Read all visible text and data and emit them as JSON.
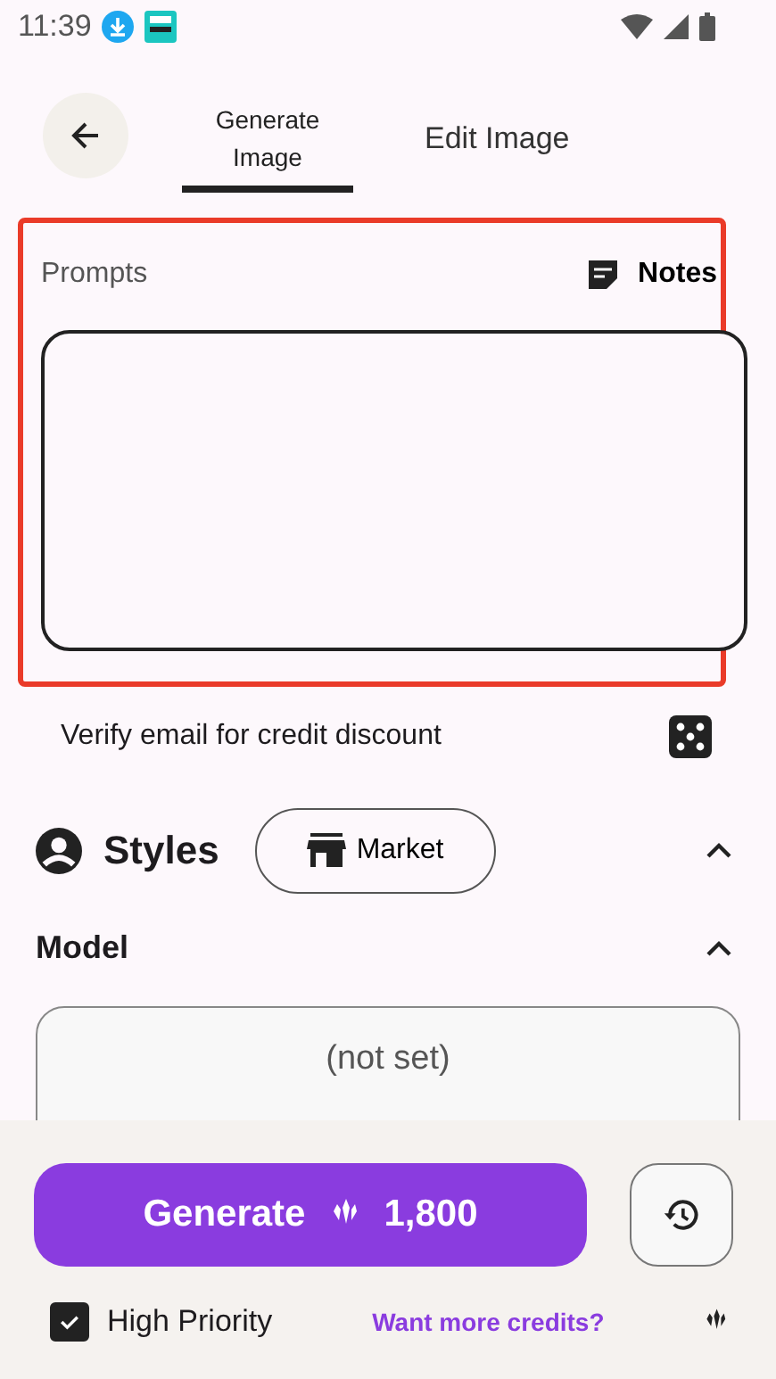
{
  "status_bar": {
    "time": "11:39"
  },
  "tabs": [
    {
      "label": "Generate\nImage",
      "selected": true
    },
    {
      "label": "Edit Image",
      "selected": false
    }
  ],
  "prompts": {
    "label": "Prompts",
    "notes_label": "Notes",
    "highlighted": true
  },
  "verify_text": "Verify email for credit discount",
  "styles": {
    "title": "Styles",
    "market_label": "Market",
    "expanded": true
  },
  "model": {
    "title": "Model",
    "expanded": true,
    "value": "(not set)"
  },
  "generate": {
    "label": "Generate",
    "cost": "1,800"
  },
  "high_priority": {
    "label": "High Priority",
    "checked": true
  },
  "credits_link": "Want more credits?"
}
